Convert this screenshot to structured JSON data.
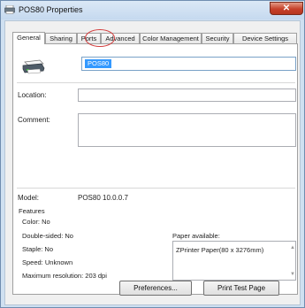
{
  "window": {
    "title": "POS80 Properties",
    "close_label": "✕"
  },
  "tabs": [
    {
      "label": "General"
    },
    {
      "label": "Sharing"
    },
    {
      "label": "Ports"
    },
    {
      "label": "Advanced"
    },
    {
      "label": "Color Management"
    },
    {
      "label": "Security"
    },
    {
      "label": "Device Settings"
    }
  ],
  "general": {
    "printer_name": "POS80",
    "location_label": "Location:",
    "location_value": "",
    "comment_label": "Comment:",
    "comment_value": "",
    "model_label": "Model:",
    "model_value": "POS80 10.0.0.7",
    "features_label": "Features",
    "features": {
      "color": "Color: No",
      "double_sided": "Double-sided: No",
      "staple": "Staple: No",
      "speed": "Speed: Unknown",
      "max_resolution": "Maximum resolution: 203 dpi"
    },
    "paper_available_label": "Paper available:",
    "paper_items": [
      "ZPrinter Paper(80 x 3276mm)"
    ]
  },
  "buttons": {
    "preferences": "Preferences...",
    "print_test_page": "Print Test Page"
  },
  "colors": {
    "annotation_circle": "#d23c3c",
    "selection": "#3399ff"
  }
}
